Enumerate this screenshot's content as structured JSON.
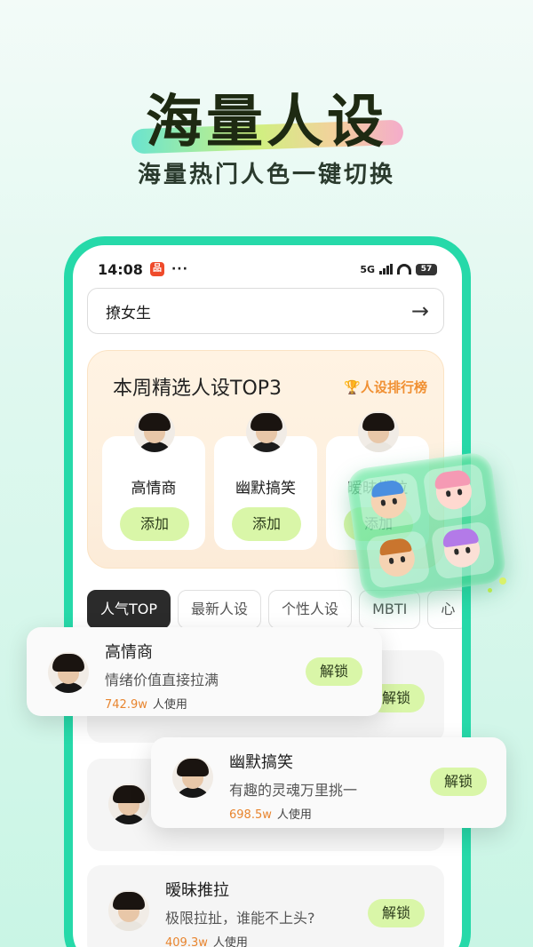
{
  "hero": {
    "title": "海量人设",
    "subtitle": "海量热门人色一键切换"
  },
  "status_bar": {
    "time": "14:08",
    "app_badge": "品",
    "more": "···",
    "network": "5G",
    "battery": "57"
  },
  "search": {
    "value": "撩女生"
  },
  "top3": {
    "title": "本周精选人设TOP3",
    "ranking_link": "人设排行榜",
    "cards": [
      {
        "name": "高情商",
        "button": "添加"
      },
      {
        "name": "幽默搞笑",
        "button": "添加"
      },
      {
        "name": "暧昧推拉",
        "button": "添加"
      }
    ]
  },
  "tabs": [
    "人气TOP",
    "最新人设",
    "个性人设",
    "MBTI",
    "心"
  ],
  "list": [
    {
      "name": "高情商",
      "desc": "情绪价值直接拉满",
      "users_num": "742.9w",
      "users_label": "人使用",
      "button": "解锁"
    },
    {
      "name": "幽默搞笑",
      "desc": "有趣的灵魂万里挑一",
      "users_num": "698.5w",
      "users_label": "人使用",
      "button": "解锁"
    },
    {
      "name": "暧昧推拉",
      "desc": "极限拉扯，谁能不上头?",
      "users_num": "409.3w",
      "users_label": "人使用",
      "button": "解锁"
    }
  ],
  "colors": {
    "accent_frame": "#26d9a9",
    "button_green": "#d9f6a8",
    "highlight_orange": "#e8852f"
  }
}
